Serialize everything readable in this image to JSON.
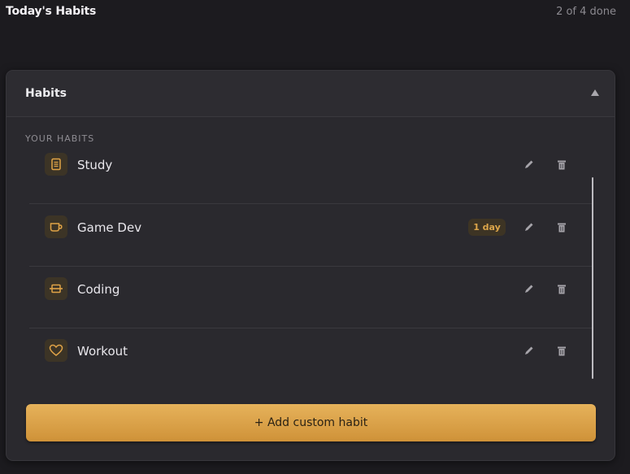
{
  "app": {
    "title": "Today's Habits",
    "progress": "2 of 4 done"
  },
  "panel": {
    "title": "Habits",
    "section_label": "YOUR HABITS",
    "add_button_label": "+ Add custom habit"
  },
  "habits": [
    {
      "name": "Study",
      "icon": "book-icon",
      "streak": ""
    },
    {
      "name": "Game Dev",
      "icon": "coffee-cup-icon",
      "streak": "1 day"
    },
    {
      "name": "Coding",
      "icon": "dumbbell-icon",
      "streak": ""
    },
    {
      "name": "Workout",
      "icon": "heart-icon",
      "streak": ""
    }
  ],
  "colors": {
    "background": "#1c1b1f",
    "panel": "#2a292e",
    "accent": "#e0a347",
    "icon_tile": "#3c3426"
  }
}
